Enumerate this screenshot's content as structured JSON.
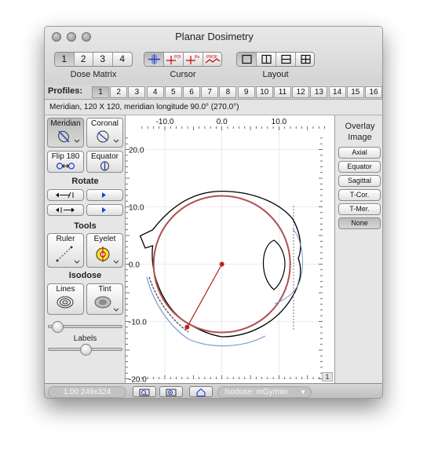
{
  "window": {
    "title": "Planar Dosimetry"
  },
  "toolbar": {
    "dose_matrix": {
      "label": "Dose Matrix",
      "options": [
        "1",
        "2",
        "3",
        "4"
      ],
      "selected": "1"
    },
    "cursor": {
      "label": "Cursor",
      "icons": [
        "crosshair-icon",
        "poi-cursor-icon",
        "rx-cursor-icon",
        "prof-cursor-icon"
      ],
      "badges": [
        "POI",
        "Rx",
        "PROF"
      ]
    },
    "layout": {
      "label": "Layout",
      "icons": [
        "single-pane-icon",
        "two-column-icon",
        "two-row-icon",
        "four-pane-icon"
      ]
    }
  },
  "profiles": {
    "label": "Profiles:",
    "items": [
      "1",
      "2",
      "3",
      "4",
      "5",
      "6",
      "7",
      "8",
      "9",
      "10",
      "11",
      "12",
      "13",
      "14",
      "15",
      "16"
    ],
    "selected": "1"
  },
  "info": {
    "text": "Meridian, 120 X 120, meridian longitude 90.0° (270.0°)"
  },
  "left_panel": {
    "view_buttons": [
      {
        "label": "Meridian",
        "icon": "meridian-icon",
        "selected": true
      },
      {
        "label": "Coronal",
        "icon": "coronal-icon",
        "selected": false
      },
      {
        "label": "Flip 180",
        "icon": "flip-icon",
        "selected": false
      },
      {
        "label": "Equator",
        "icon": "equator-icon",
        "selected": false
      }
    ],
    "rotate_label": "Rotate",
    "tools_label": "Tools",
    "tools": [
      {
        "label": "Ruler",
        "icon": "ruler-icon"
      },
      {
        "label": "Eyelet",
        "icon": "eyelet-icon"
      }
    ],
    "isodose_label": "Isodose",
    "isodose": [
      {
        "label": "Lines",
        "icon": "isodose-lines-icon"
      },
      {
        "label": "Tint",
        "icon": "tint-icon"
      }
    ],
    "labels_label": "Labels",
    "slider1_value": 0.05,
    "slider2_value": 0.5
  },
  "plot": {
    "x_ticks": [
      "-10.0",
      "0.0",
      "10.0"
    ],
    "y_ticks": [
      "20.0",
      "10.0",
      "0.0",
      "-10.0",
      "-20.0"
    ],
    "x_range": [
      -14.0,
      18.0
    ],
    "y_range": [
      -22.0,
      22.0
    ],
    "corner_label": "1",
    "colors": {
      "sclera": "#000000",
      "retina": "#b05050",
      "applicator": "#7a9bd0",
      "ruler": "#b02020"
    },
    "ruler_points": [
      [
        0.0,
        0.0
      ],
      [
        -6.1,
        -11.0
      ]
    ]
  },
  "overlay": {
    "title": "Overlay Image",
    "options": [
      "Axial",
      "Equator",
      "Sagittal",
      "T-Cor.",
      "T-Mer.",
      "None"
    ],
    "selected": "None"
  },
  "status": {
    "zoom": "1.00 249x324",
    "isodose_menu": "Isodose: mGy/min",
    "icons": [
      "zoom-out-icon",
      "zoom-in-icon",
      "home-icon"
    ]
  }
}
